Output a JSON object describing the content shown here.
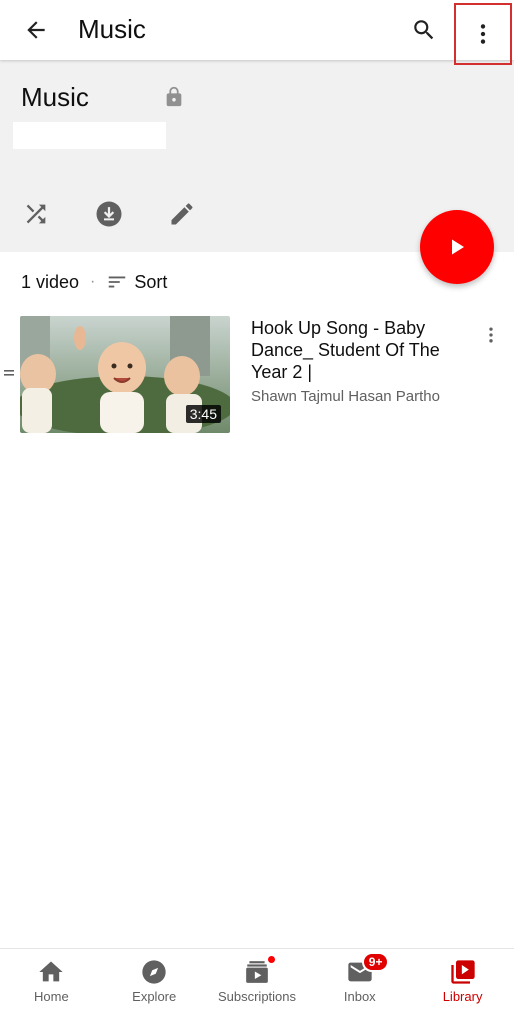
{
  "appbar": {
    "title": "Music",
    "back_icon": "arrow-back-icon",
    "search_icon": "search-icon",
    "more_icon": "more-vert-icon",
    "highlight_color": "#d32f2f"
  },
  "playlist": {
    "title": "Music",
    "privacy_icon": "lock-icon",
    "actions": [
      {
        "name": "shuffle",
        "icon": "shuffle-icon"
      },
      {
        "name": "download",
        "icon": "download-icon"
      },
      {
        "name": "edit",
        "icon": "edit-icon"
      }
    ],
    "play_all_icon": "play-icon",
    "accent": "#ff0000"
  },
  "list": {
    "count_label": "1 video",
    "separator": "·",
    "sort_label": "Sort",
    "videos": [
      {
        "title": "Hook Up Song - Baby Dance_ Student Of The Year 2 |",
        "channel": "Shawn Tajmul Hasan Partho",
        "duration": "3:45"
      }
    ]
  },
  "bottom_nav": {
    "items": [
      {
        "label": "Home",
        "icon": "home-icon"
      },
      {
        "label": "Explore",
        "icon": "compass-icon"
      },
      {
        "label": "Subscriptions",
        "icon": "subscriptions-icon"
      },
      {
        "label": "Inbox",
        "icon": "mail-icon",
        "badge": "9+"
      },
      {
        "label": "Library",
        "icon": "library-icon"
      }
    ],
    "active_color": "#cc0000"
  }
}
